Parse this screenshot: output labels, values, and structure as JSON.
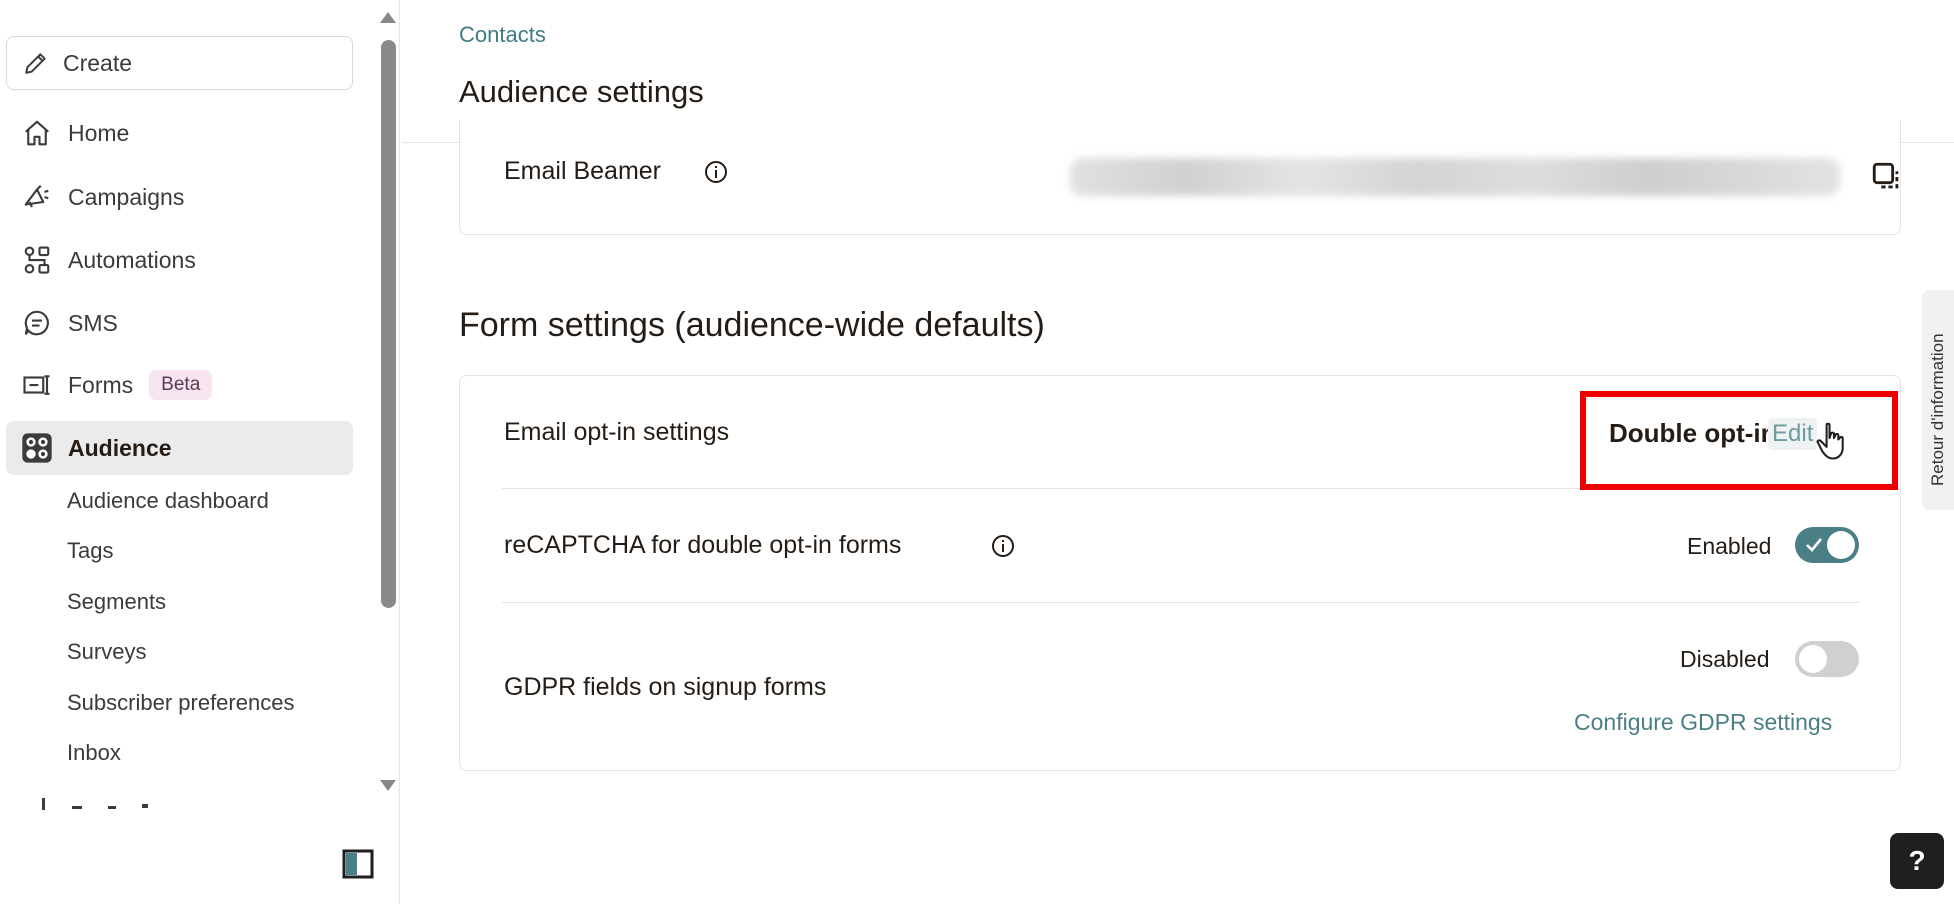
{
  "sidebar": {
    "create_label": "Create",
    "nav": [
      {
        "label": "Home",
        "icon": "home-icon"
      },
      {
        "label": "Campaigns",
        "icon": "megaphone-icon"
      },
      {
        "label": "Automations",
        "icon": "automation-icon"
      },
      {
        "label": "SMS",
        "icon": "sms-icon"
      },
      {
        "label": "Forms",
        "icon": "forms-icon",
        "badge": "Beta"
      },
      {
        "label": "Audience",
        "icon": "audience-icon",
        "active": true
      }
    ],
    "audience_sub": [
      "Audience dashboard",
      "Tags",
      "Segments",
      "Surveys",
      "Subscriber preferences",
      "Inbox"
    ]
  },
  "header": {
    "breadcrumb": "Contacts",
    "title": "Audience settings"
  },
  "email_beamer": {
    "label": "Email Beamer"
  },
  "form_settings": {
    "title": "Form settings (audience-wide defaults)",
    "email_optin": {
      "label": "Email opt-in settings",
      "value": "Double opt-in",
      "edit_label": "Edit"
    },
    "recaptcha": {
      "label": "reCAPTCHA for double opt-in forms",
      "status": "Enabled",
      "enabled": true
    },
    "gdpr": {
      "label": "GDPR fields on signup forms",
      "status": "Disabled",
      "enabled": false,
      "link": "Configure GDPR settings"
    }
  },
  "feedback_tab": "Retour d'information",
  "help_label": "?",
  "colors": {
    "accent": "#4a7f86",
    "link": "#3f7d82",
    "highlight": "#ee0000",
    "active_nav_bg": "#ebebeb"
  }
}
